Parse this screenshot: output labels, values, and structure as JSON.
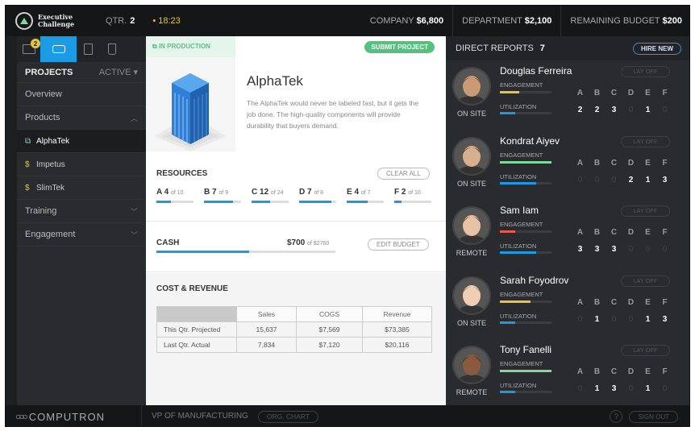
{
  "header": {
    "logo_line1": "Executive",
    "logo_line2": "Challenge",
    "qtr_label": "QTR.",
    "qtr_value": "2",
    "time": "18:23",
    "company_label": "COMPANY",
    "company_value": "$6,800",
    "department_label": "DEPARTMENT",
    "department_value": "$2,100",
    "remaining_label": "REMAINING BUDGET",
    "remaining_value": "$200"
  },
  "sidebar": {
    "mail_badge": "2",
    "projects_label": "PROJECTS",
    "filter_label": "ACTIVE ▾",
    "overview": "Overview",
    "products": "Products",
    "product_items": [
      "AlphaTek",
      "Impetus",
      "SlimTek"
    ],
    "training": "Training",
    "engagement": "Engagement",
    "icons": [
      "mail-icon",
      "layers-icon",
      "document-icon",
      "beaker-icon"
    ]
  },
  "project": {
    "status": "IN PRODUCTION",
    "submit_label": "SUBMIT PROJECT",
    "name": "AlphaTek",
    "description": "The AlphaTek would never be labeled fast, but it gets the job done. The high-quality components will provide durability that buyers demand."
  },
  "resources": {
    "title": "RESOURCES",
    "clear_label": "CLEAR ALL",
    "items": [
      {
        "letter": "A",
        "value": "4",
        "total": "of 10",
        "fraction": 0.4
      },
      {
        "letter": "B",
        "value": "7",
        "total": "of 9",
        "fraction": 0.78
      },
      {
        "letter": "C",
        "value": "12",
        "total": "of 24",
        "fraction": 0.5
      },
      {
        "letter": "D",
        "value": "7",
        "total": "of 8",
        "fraction": 0.88
      },
      {
        "letter": "E",
        "value": "4",
        "total": "of 7",
        "fraction": 0.57
      },
      {
        "letter": "F",
        "value": "2",
        "total": "of 10",
        "fraction": 0.2
      }
    ]
  },
  "cash": {
    "label": "CASH",
    "value": "$700",
    "total": "of $2760",
    "fraction": 0.52,
    "edit_label": "EDIT BUDGET"
  },
  "cost_revenue": {
    "title": "COST & REVENUE",
    "columns": [
      "Sales",
      "COGS",
      "Revenue"
    ],
    "rows": [
      {
        "label": "This Qtr. Projected",
        "values": [
          "15,637",
          "$7,569",
          "$73,385"
        ]
      },
      {
        "label": "Last Qtr. Actual",
        "values": [
          "7,834",
          "$7,120",
          "$20,116"
        ]
      }
    ]
  },
  "reports": {
    "title": "DIRECT REPORTS",
    "count": "7",
    "hire_label": "HIRE NEW",
    "layoff_label": "LAY OFF",
    "engagement_label": "ENGAGEMENT",
    "utilization_label": "UTILIZATION",
    "grade_letters": [
      "A",
      "B",
      "C",
      "D",
      "E",
      "F"
    ],
    "employees": [
      {
        "name": "Douglas Ferreira",
        "location": "ON SITE",
        "engagement": 0.38,
        "engagement_color": "#e9c43a",
        "utilization": 0.3,
        "grades": [
          "2",
          "2",
          "3",
          "0",
          "1",
          "0"
        ],
        "skin": "#c99a76",
        "hair": "#4a3524"
      },
      {
        "name": "Kondrat Aiyev",
        "location": "ON SITE",
        "engagement": 1.0,
        "engagement_color": "#7ed99b",
        "utilization": 0.7,
        "grades": [
          "0",
          "0",
          "0",
          "2",
          "1",
          "3"
        ],
        "skin": "#d6b08e",
        "hair": "#2b2118"
      },
      {
        "name": "Sam Iam",
        "location": "REMOTE",
        "engagement": 0.3,
        "engagement_color": "#e85a4f",
        "utilization": 0.7,
        "grades": [
          "3",
          "3",
          "3",
          "0",
          "0",
          "0"
        ],
        "skin": "#e8c2a4",
        "hair": "#3a1f14"
      },
      {
        "name": "Sarah Foyodrov",
        "location": "ON SITE",
        "engagement": 0.6,
        "engagement_color": "#e9c43a",
        "utilization": 0.3,
        "grades": [
          "0",
          "1",
          "0",
          "0",
          "1",
          "3"
        ],
        "skin": "#efcfb4",
        "hair": "#8a6a4a"
      },
      {
        "name": "Tony Fanelli",
        "location": "REMOTE",
        "engagement": 1.0,
        "engagement_color": "#7ed99b",
        "utilization": 0.3,
        "grades": [
          "0",
          "1",
          "3",
          "0",
          "1",
          "0"
        ],
        "skin": "#8a5a3e",
        "hair": "#1b1512"
      }
    ]
  },
  "footer": {
    "brand": "COMPUTRON",
    "role": "VP OF MANUFACTURING",
    "org_chart_label": "ORG. CHART",
    "help_label": "?",
    "signout_label": "SIGN OUT"
  },
  "colors": {
    "accent_blue": "#1b9be4",
    "accent_green": "#54c17f",
    "accent_yellow": "#e9c43a"
  }
}
